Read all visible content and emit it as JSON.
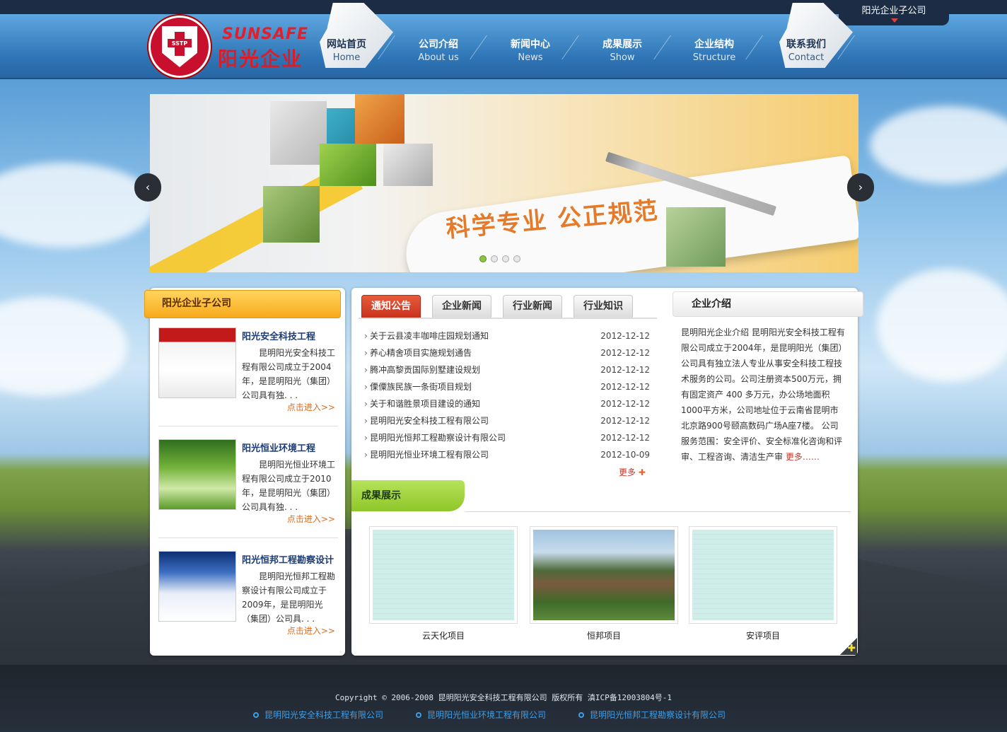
{
  "header": {
    "logo_en": "SUNSAFE",
    "logo_cn": "阳光企业",
    "logo_badge": "SSTP",
    "subsidiary_tab": "阳光企业子公司"
  },
  "nav": [
    {
      "cn": "网站首页",
      "en": "Home",
      "active": true
    },
    {
      "cn": "公司介绍",
      "en": "About us"
    },
    {
      "cn": "新闻中心",
      "en": "News"
    },
    {
      "cn": "成果展示",
      "en": "Show"
    },
    {
      "cn": "企业结构",
      "en": "Structure"
    },
    {
      "cn": "联系我们",
      "en": "Contact"
    }
  ],
  "banner": {
    "slogan": "科学专业  公正规范",
    "prev_icon": "chevron-left-icon",
    "next_icon": "chevron-right-icon",
    "slide_count": 4,
    "active_slide": 1
  },
  "left": {
    "title": "阳光企业子公司",
    "items": [
      {
        "name": "阳光安全科技工程",
        "desc": "昆明阳光安全科技工程有限公司成立于2004年，是昆明阳光（集团）公司具有独. . .",
        "more": "点击进入>>"
      },
      {
        "name": "阳光恒业环境工程",
        "desc": "昆明阳光恒业环境工程有限公司成立于2010年，是昆明阳光（集团）公司具有独. . .",
        "more": "点击进入>>"
      },
      {
        "name": "阳光恒邦工程勘察设计",
        "desc": "昆明阳光恒邦工程勘察设计有限公司成立于2009年，是昆明阳光（集团）公司具. . .",
        "more": "点击进入>>"
      }
    ]
  },
  "tabs": [
    "通知公告",
    "企业新闻",
    "行业新闻",
    "行业知识"
  ],
  "news": [
    {
      "title": "关于云县凌丰咖啡庄园规划通知",
      "date": "2012-12-12"
    },
    {
      "title": "养心精舍项目实施规划通告",
      "date": "2012-12-12"
    },
    {
      "title": "腾冲高黎贡国际别墅建设规划",
      "date": "2012-12-12"
    },
    {
      "title": "傈僳族民族一条街项目规划",
      "date": "2012-12-12"
    },
    {
      "title": "关于和谐胜景项目建设的通知",
      "date": "2012-12-12"
    },
    {
      "title": "昆明阳光安全科技工程有限公司",
      "date": "2012-12-12"
    },
    {
      "title": "昆明阳光恒邦工程勘察设计有限公司",
      "date": "2012-12-12"
    },
    {
      "title": "昆明阳光恒业环境工程有限公司",
      "date": "2012-10-09"
    }
  ],
  "news_more": "更多",
  "intro": {
    "title": "企业介绍",
    "text": "昆明阳光企业介绍    昆明阳光安全科技工程有限公司成立于2004年，是昆明阳光（集团）公司具有独立法人专业从事安全科技工程技术服务的公司。公司注册资本500万元，拥有固定资产 400 多万元，办公场地面积1000平方米，公司地址位于云南省昆明市北京路900号颐高数码广场A座7楼。 公司服务范围：安全评价、安全标准化咨询和评审、工程咨询、清洁生产审",
    "more": "更多……"
  },
  "show": {
    "title": "成果展示",
    "items": [
      {
        "name": "云天化项目"
      },
      {
        "name": "恒邦项目"
      },
      {
        "name": "安评项目"
      }
    ]
  },
  "footer": {
    "copyright": "Copyright © 2006-2008 昆明阳光安全科技工程有限公司 版权所有 滇ICP备12003804号-1",
    "links": [
      "昆明阳光安全科技工程有限公司",
      "昆明阳光恒业环境工程有限公司",
      "昆明阳光恒邦工程勘察设计有限公司"
    ]
  },
  "colors": {
    "accent": "#f7a91c",
    "tab_active": "#c8321d",
    "show_green": "#8fc629",
    "link_blue": "#3f9ee8"
  }
}
